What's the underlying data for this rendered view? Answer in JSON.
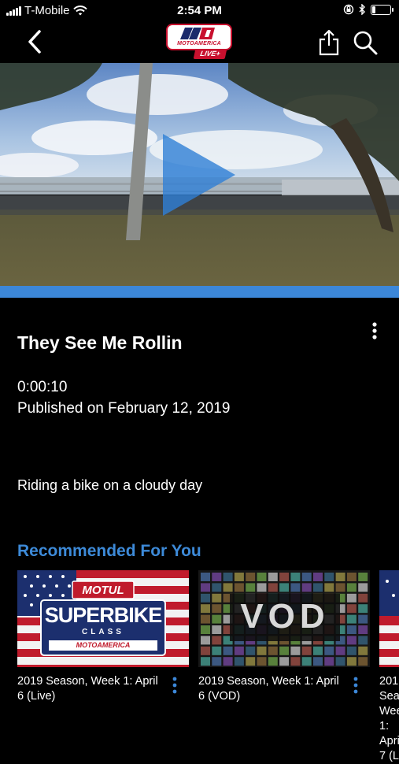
{
  "status_bar": {
    "carrier": "T-Mobile",
    "time": "2:54 PM",
    "battery_level": 0.25
  },
  "nav": {
    "back_icon": "chevron-left-icon",
    "logo_text": "MOTOAMERICA",
    "logo_badge": "LIVE+",
    "share_icon": "share-icon",
    "search_icon": "search-icon"
  },
  "video": {
    "play_icon": "play-icon",
    "progress": 1.0
  },
  "details": {
    "title": "They See Me Rollin",
    "duration": "0:00:10",
    "published": "Published on February 12, 2019",
    "description": "Riding a bike on a cloudy day",
    "more_icon": "more-vertical-icon"
  },
  "recommended": {
    "heading": "Recommended For You",
    "items": [
      {
        "title": "2019 Season, Week 1: April 6 (Live)",
        "thumb_brand": "MOTUL",
        "thumb_line1": "SUPERBIKE",
        "thumb_line2": "CLASS",
        "thumb_footer": "MOTOAMERICA"
      },
      {
        "title": "2019 Season, Week 1: April 6 (VOD)",
        "thumb_text": "VOD"
      },
      {
        "title": "2019 Season, Week 1: April 7 (L"
      }
    ]
  },
  "colors": {
    "accent": "#3c87d8",
    "heading_blue": "#3d8ad8",
    "background": "#000000",
    "brand_red": "#c8102e"
  }
}
